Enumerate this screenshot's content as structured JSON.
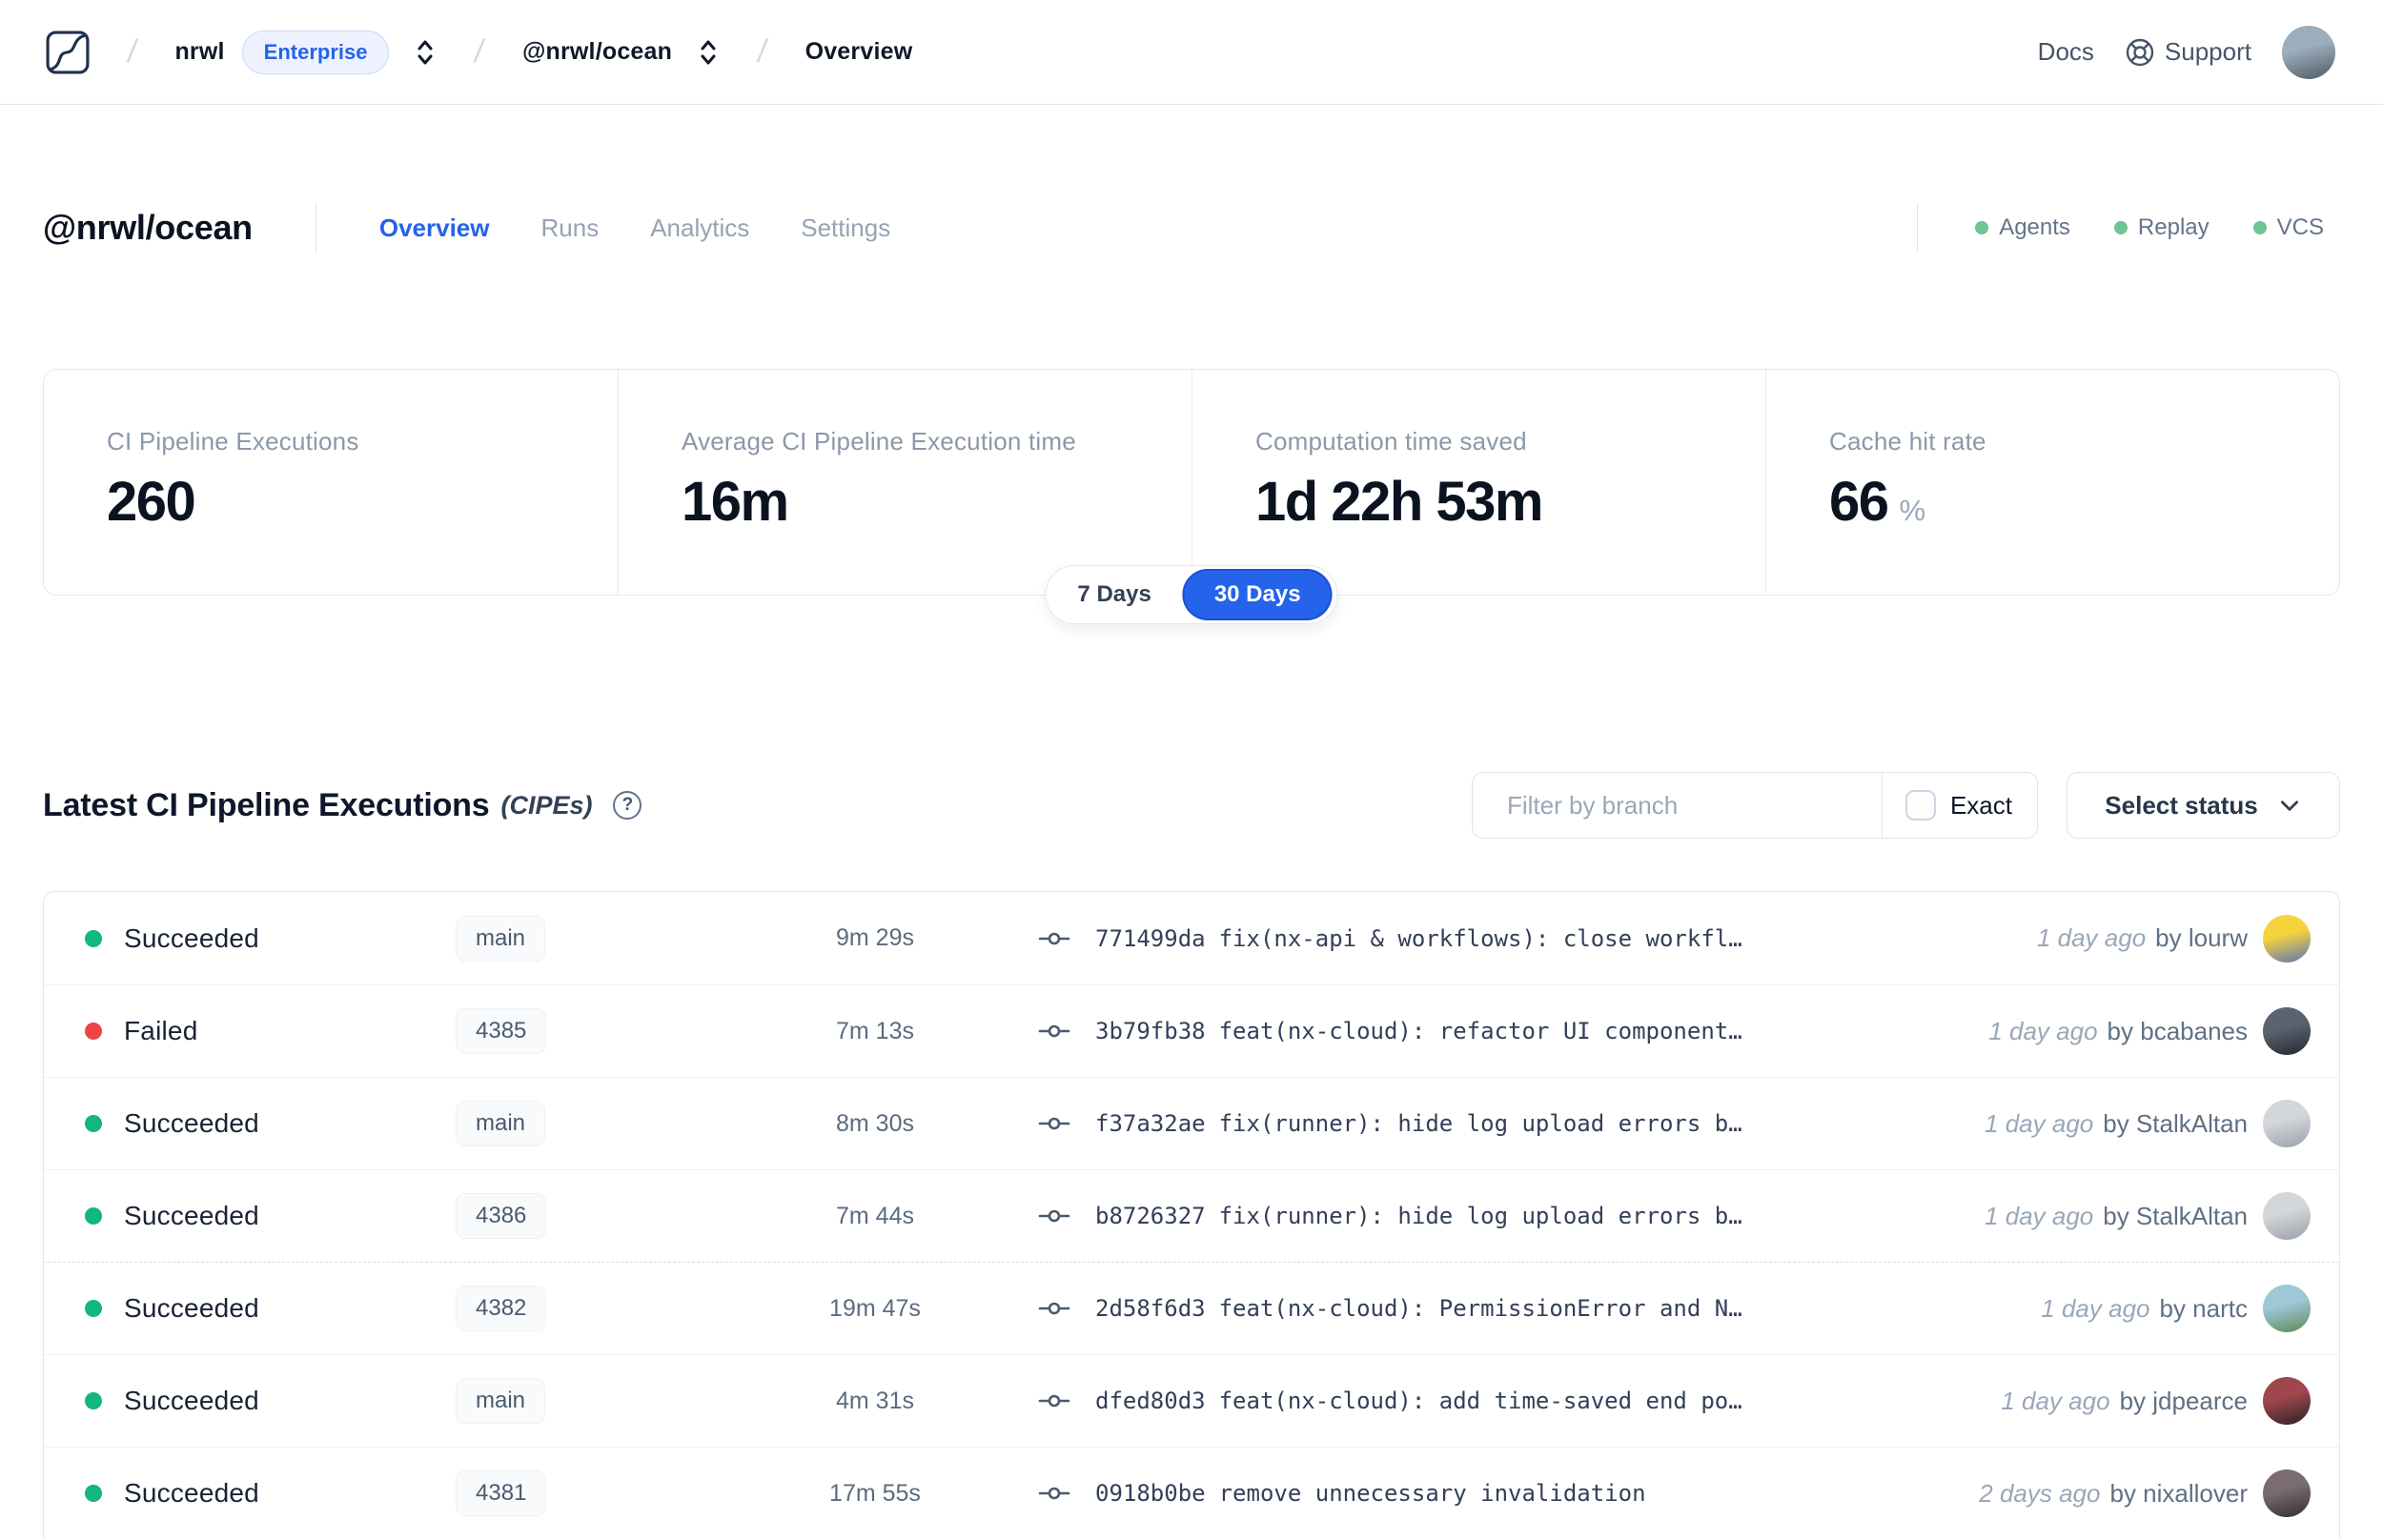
{
  "icons": {
    "help_glyph": "?",
    "separator": "/"
  },
  "colors": {
    "accent_blue": "#2563eb",
    "success_green": "#12b680",
    "fail_red": "#ee4444",
    "indicator_green": "#6ec492"
  },
  "topbar": {
    "breadcrumb": {
      "org": "nrwl",
      "org_badge": "Enterprise",
      "workspace": "@nrwl/ocean",
      "page": "Overview"
    },
    "docs_label": "Docs",
    "support_label": "Support",
    "user_avatar_colors": [
      "#9cadbb",
      "#4f5b66"
    ]
  },
  "workspace_header": {
    "title": "@nrwl/ocean",
    "tabs": [
      {
        "label": "Overview",
        "active": true
      },
      {
        "label": "Runs",
        "active": false
      },
      {
        "label": "Analytics",
        "active": false
      },
      {
        "label": "Settings",
        "active": false
      }
    ],
    "indicators": [
      {
        "label": "Agents"
      },
      {
        "label": "Replay"
      },
      {
        "label": "VCS"
      }
    ]
  },
  "stats": {
    "cards": [
      {
        "label": "CI Pipeline Executions",
        "value": "260"
      },
      {
        "label": "Average CI Pipeline Execution time",
        "value": "16m"
      },
      {
        "label": "Computation time saved",
        "value": "1d 22h 53m"
      },
      {
        "label": "Cache hit rate",
        "value": "66",
        "suffix": "%"
      }
    ],
    "period": {
      "options": [
        "7 Days",
        "30 Days"
      ],
      "selected": "30 Days"
    }
  },
  "cipe_section": {
    "title": "Latest CI Pipeline Executions",
    "subtitle": "(CIPEs)",
    "filter_placeholder": "Filter by branch",
    "exact_label": "Exact",
    "status_dropdown_label": "Select status"
  },
  "table": {
    "rows": [
      {
        "status": "Succeeded",
        "dot_color": "#12b680",
        "branch": "main",
        "duration": "9m 29s",
        "commit_hash": "771499da",
        "commit_message": "fix(nx-api & workflows): close workfl…",
        "time_ago": "1 day ago",
        "author": "by lourw",
        "avatar_colors": [
          "#f5d33d",
          "#5a74b8"
        ]
      },
      {
        "status": "Failed",
        "dot_color": "#ee4444",
        "branch": "4385",
        "duration": "7m 13s",
        "commit_hash": "3b79fb38",
        "commit_message": "feat(nx-cloud): refactor UI component…",
        "time_ago": "1 day ago",
        "author": "by bcabanes",
        "avatar_colors": [
          "#5a6470",
          "#23282f"
        ]
      },
      {
        "status": "Succeeded",
        "dot_color": "#12b680",
        "branch": "main",
        "duration": "8m 30s",
        "commit_hash": "f37a32ae",
        "commit_message": "fix(runner): hide log upload errors b…",
        "time_ago": "1 day ago",
        "author": "by StalkAltan",
        "avatar_colors": [
          "#d3d7db",
          "#9aa1a8"
        ]
      },
      {
        "status": "Succeeded",
        "dot_color": "#12b680",
        "branch": "4386",
        "duration": "7m 44s",
        "commit_hash": "b8726327",
        "commit_message": "fix(runner): hide log upload errors b…",
        "time_ago": "1 day ago",
        "author": "by StalkAltan",
        "avatar_colors": [
          "#d3d7db",
          "#9aa1a8"
        ]
      },
      {
        "status": "Succeeded",
        "dot_color": "#12b680",
        "branch": "4382",
        "duration": "19m 47s",
        "commit_hash": "2d58f6d3",
        "commit_message": "feat(nx-cloud): PermissionError and N…",
        "time_ago": "1 day ago",
        "author": "by nartc",
        "avatar_colors": [
          "#9ec7d8",
          "#5e8a57"
        ]
      },
      {
        "status": "Succeeded",
        "dot_color": "#12b680",
        "branch": "main",
        "duration": "4m 31s",
        "commit_hash": "dfed80d3",
        "commit_message": "feat(nx-cloud): add time-saved end po…",
        "time_ago": "1 day ago",
        "author": "by jdpearce",
        "avatar_colors": [
          "#a0474d",
          "#2a2226"
        ]
      },
      {
        "status": "Succeeded",
        "dot_color": "#12b680",
        "branch": "4381",
        "duration": "17m 55s",
        "commit_hash": "0918b0be",
        "commit_message": "remove unnecessary invalidation",
        "time_ago": "2 days ago",
        "author": "by nixallover",
        "avatar_colors": [
          "#7a6c72",
          "#332d33"
        ]
      }
    ]
  }
}
